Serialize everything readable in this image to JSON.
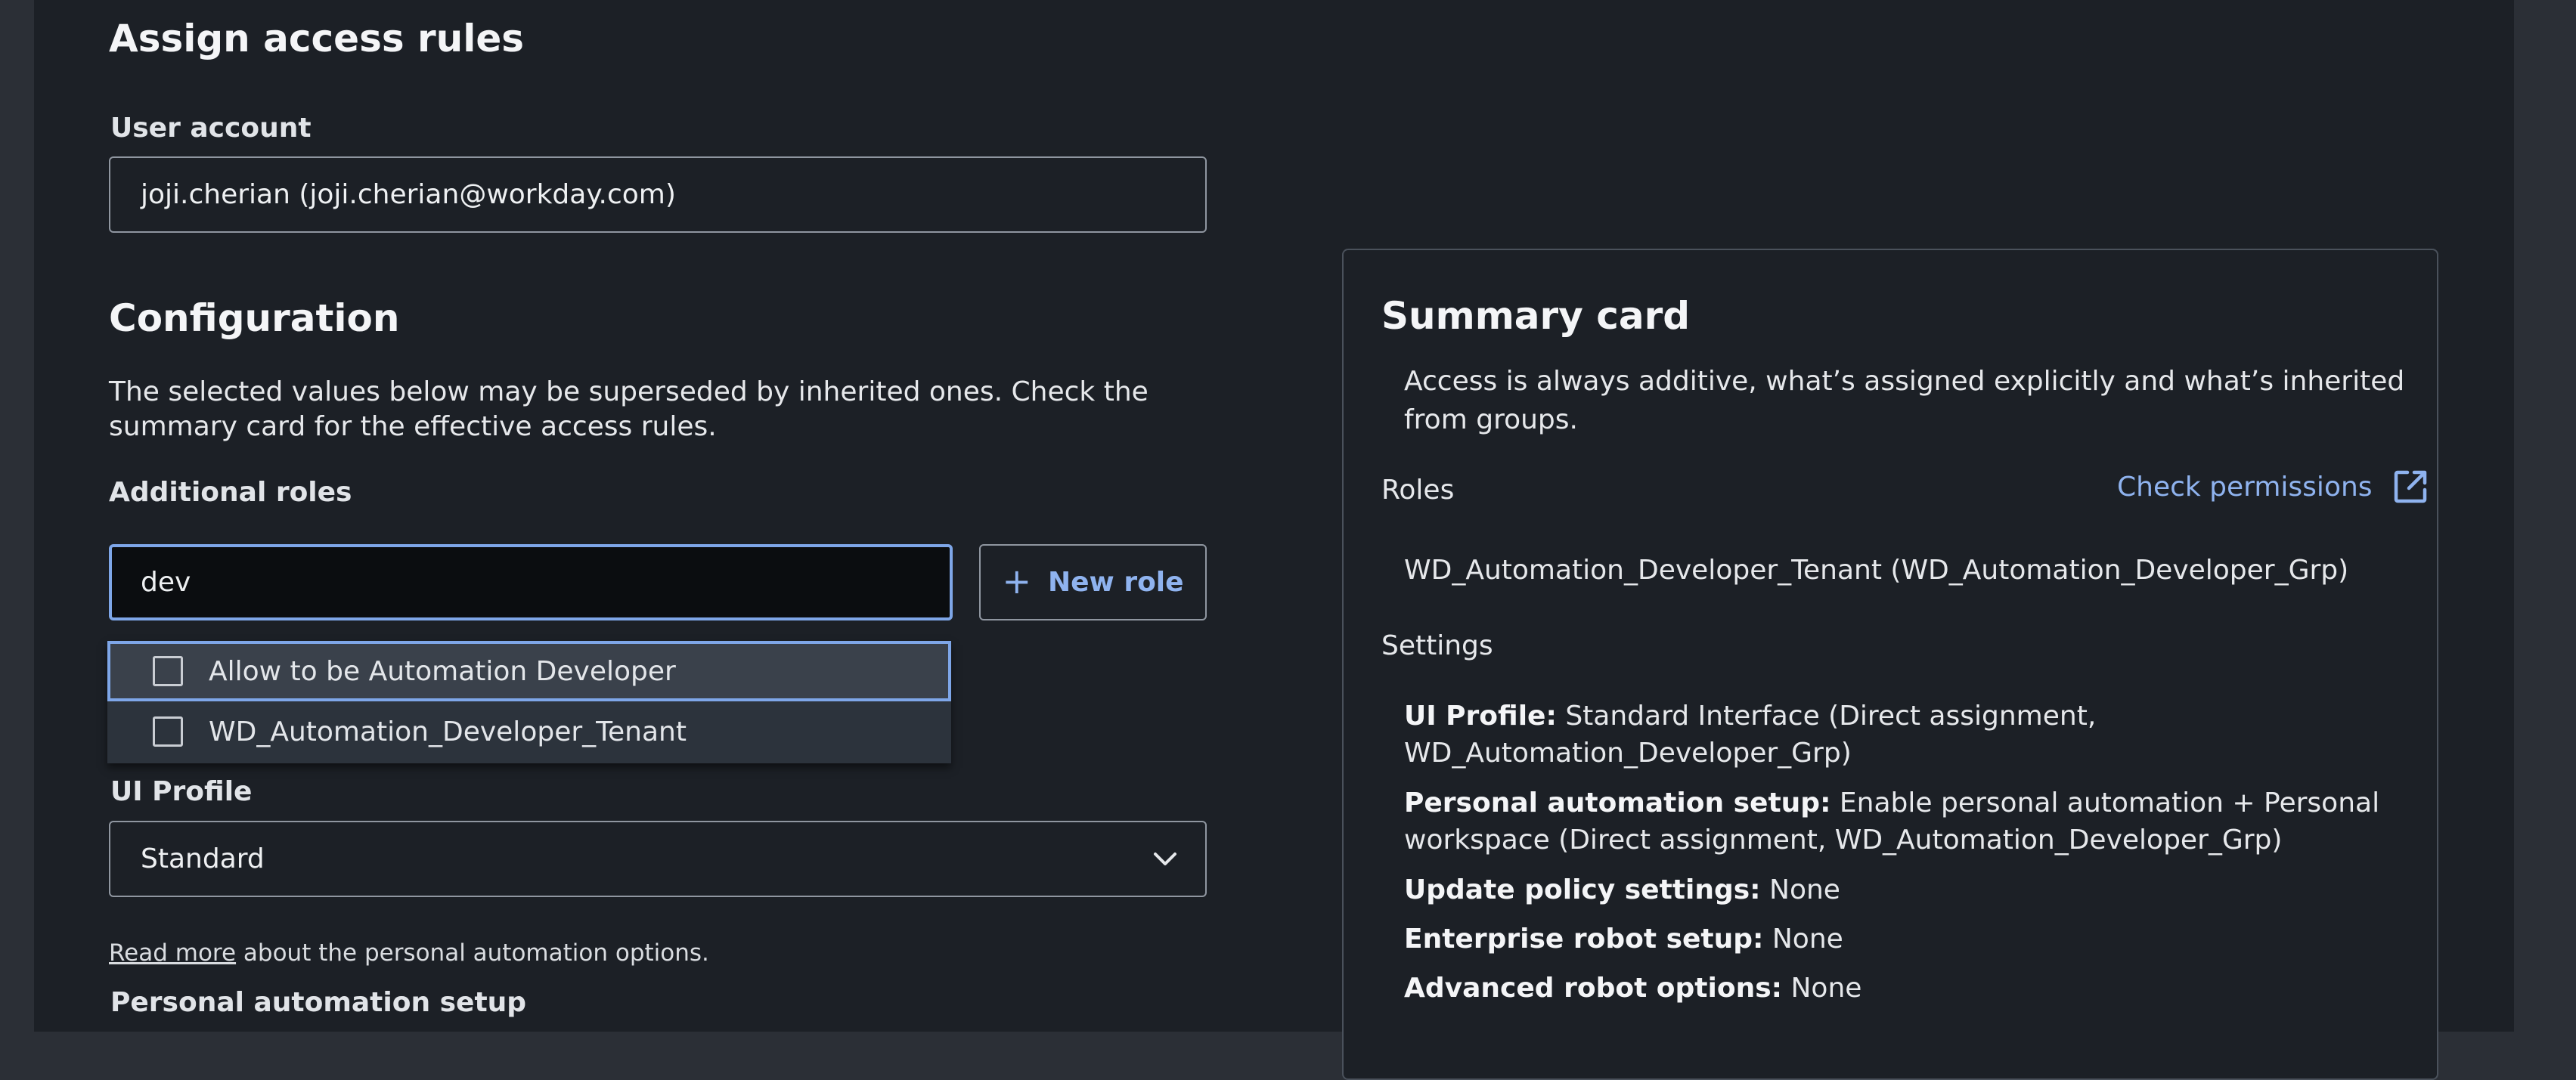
{
  "assign": {
    "title": "Assign access rules",
    "user_account_label": "User account",
    "user_account_value": "joji.cherian (joji.cherian@workday.com)"
  },
  "configuration": {
    "title": "Configuration",
    "description": "The selected values below may be superseded by inherited ones. Check the summary card for the effective access rules.",
    "additional_roles_label": "Additional roles",
    "search_value": "dev",
    "new_role_label": "New role",
    "dropdown_options": [
      {
        "label": "Allow to be Automation Developer",
        "checked": false,
        "highlighted": true
      },
      {
        "label": "WD_Automation_Developer_Tenant",
        "checked": false,
        "highlighted": false
      }
    ],
    "ui_profile_label": "UI Profile",
    "ui_profile_value": "Standard",
    "read_more_link": "Read more",
    "read_more_rest": " about the personal automation options.",
    "personal_automation_label": "Personal automation setup"
  },
  "summary": {
    "title": "Summary card",
    "description": "Access is always additive, what’s assigned explicitly and what’s inherited from groups.",
    "roles_label": "Roles",
    "check_permissions_label": "Check permissions",
    "role_value": "WD_Automation_Developer_Tenant (WD_Automation_Developer_Grp)",
    "settings_label": "Settings",
    "settings": [
      {
        "key": "UI Profile:",
        "value": " Standard Interface (Direct assignment, WD_Automation_Developer_Grp)"
      },
      {
        "key": "Personal automation setup:",
        "value": " Enable personal automation + Personal workspace (Direct assignment, WD_Automation_Developer_Grp)"
      },
      {
        "key": "Update policy settings:",
        "value": " None"
      },
      {
        "key": "Enterprise robot setup:",
        "value": " None"
      },
      {
        "key": "Advanced robot options:",
        "value": " None"
      }
    ]
  },
  "colors": {
    "accent": "#7ea6e8",
    "link": "#8fb3ef",
    "background": "#1c2026"
  },
  "icons": {
    "external_link": "external-link-icon",
    "chevron": "chevron-down-icon",
    "plus": "plus-icon"
  }
}
